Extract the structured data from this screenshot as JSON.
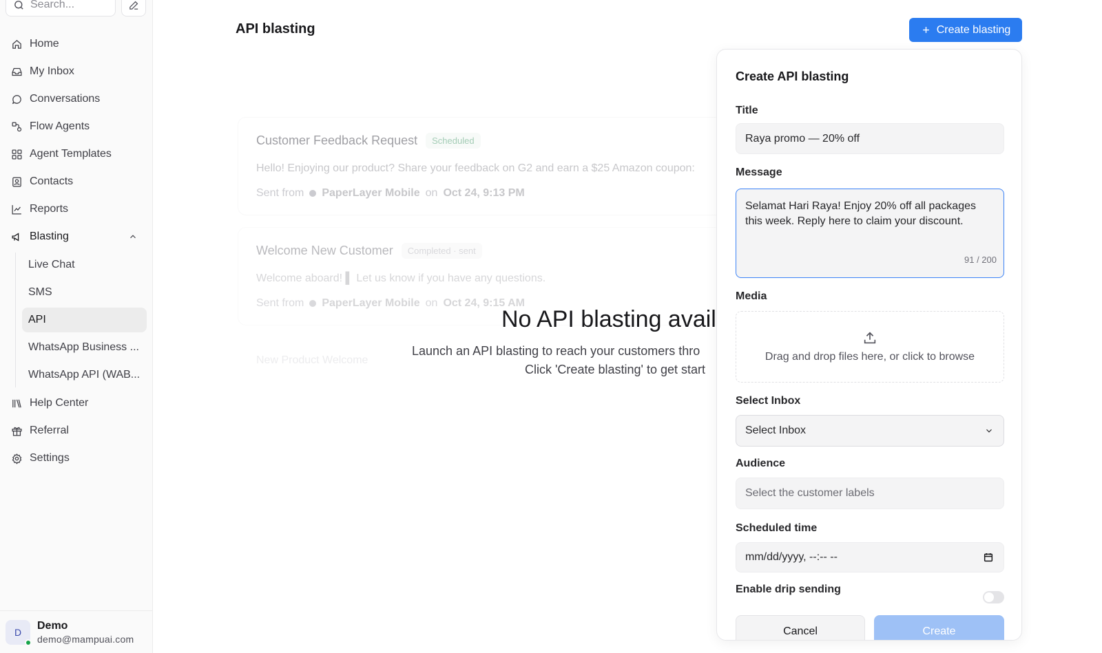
{
  "sidebar": {
    "search_placeholder": "Search...",
    "items": [
      {
        "label": "Home",
        "icon": "home-icon"
      },
      {
        "label": "My Inbox",
        "icon": "inbox-icon"
      },
      {
        "label": "Conversations",
        "icon": "chat-bubble-icon"
      },
      {
        "label": "Flow Agents",
        "icon": "flow-icon"
      },
      {
        "label": "Agent Templates",
        "icon": "grid-icon"
      },
      {
        "label": "Contacts",
        "icon": "contact-icon"
      },
      {
        "label": "Reports",
        "icon": "chart-line-icon"
      },
      {
        "label": "Blasting",
        "icon": "megaphone-icon"
      }
    ],
    "blasting_sub": [
      {
        "label": "Live Chat"
      },
      {
        "label": "SMS"
      },
      {
        "label": "API",
        "active": true
      },
      {
        "label": "WhatsApp Business ..."
      },
      {
        "label": "WhatsApp API (WAB..."
      }
    ],
    "bottom_items": [
      {
        "label": "Help Center",
        "icon": "library-icon"
      },
      {
        "label": "Referral",
        "icon": "gift-icon"
      },
      {
        "label": "Settings",
        "icon": "settings-icon"
      }
    ],
    "user": {
      "initial": "D",
      "name": "Demo",
      "email": "demo@mampuai.com"
    }
  },
  "main": {
    "title": "API blasting",
    "create_button": "Create blasting",
    "cards": [
      {
        "title": "Customer Feedback Request",
        "badge": "Scheduled",
        "message": "Hello! Enjoying our product? Share your feedback on G2 and earn a $25 Amazon coupon:",
        "sent_from_label": "Sent from",
        "sender": "PaperLayer Mobile",
        "on_label": "on",
        "time": "Oct 24, 9:13 PM"
      },
      {
        "title": "Welcome New Customer",
        "badge": "Completed · sent",
        "message": "Welcome aboard! ▌ Let us know if you have any questions.",
        "sent_from_label": "Sent from",
        "sender": "PaperLayer Mobile",
        "on_label": "on",
        "time": "Oct 24, 9:15 AM"
      }
    ],
    "ghost_text": "New Product Welcome",
    "empty_title": "No API blasting availa",
    "empty_desc_line1": "Launch an API blasting to reach your customers thro",
    "empty_desc_line2": "Click 'Create blasting' to get start"
  },
  "panel": {
    "title": "Create API blasting",
    "title_label": "Title",
    "title_value": "Raya promo — 20% off",
    "message_label": "Message",
    "message_value": "Selamat Hari Raya! Enjoy 20% off all packages this week. Reply here to claim your discount.",
    "message_counter": "91 / 200",
    "media_label": "Media",
    "media_hint": "Drag and drop files here, or click to browse",
    "inbox_label": "Select Inbox",
    "inbox_value": "Select Inbox",
    "audience_label": "Audience",
    "audience_placeholder": "Select the customer labels",
    "scheduled_label": "Scheduled time",
    "scheduled_placeholder": "mm/dd/yyyy, --:-- --",
    "drip_label": "Enable drip sending",
    "drip_enabled": false,
    "cancel_label": "Cancel",
    "create_label": "Create"
  },
  "colors": {
    "accent": "#2b7cf0",
    "create_disabled": "#9ec1f6",
    "focus_border": "#3b82f6",
    "scheduled_badge": "#58a37a",
    "online_dot": "#16a34a"
  }
}
